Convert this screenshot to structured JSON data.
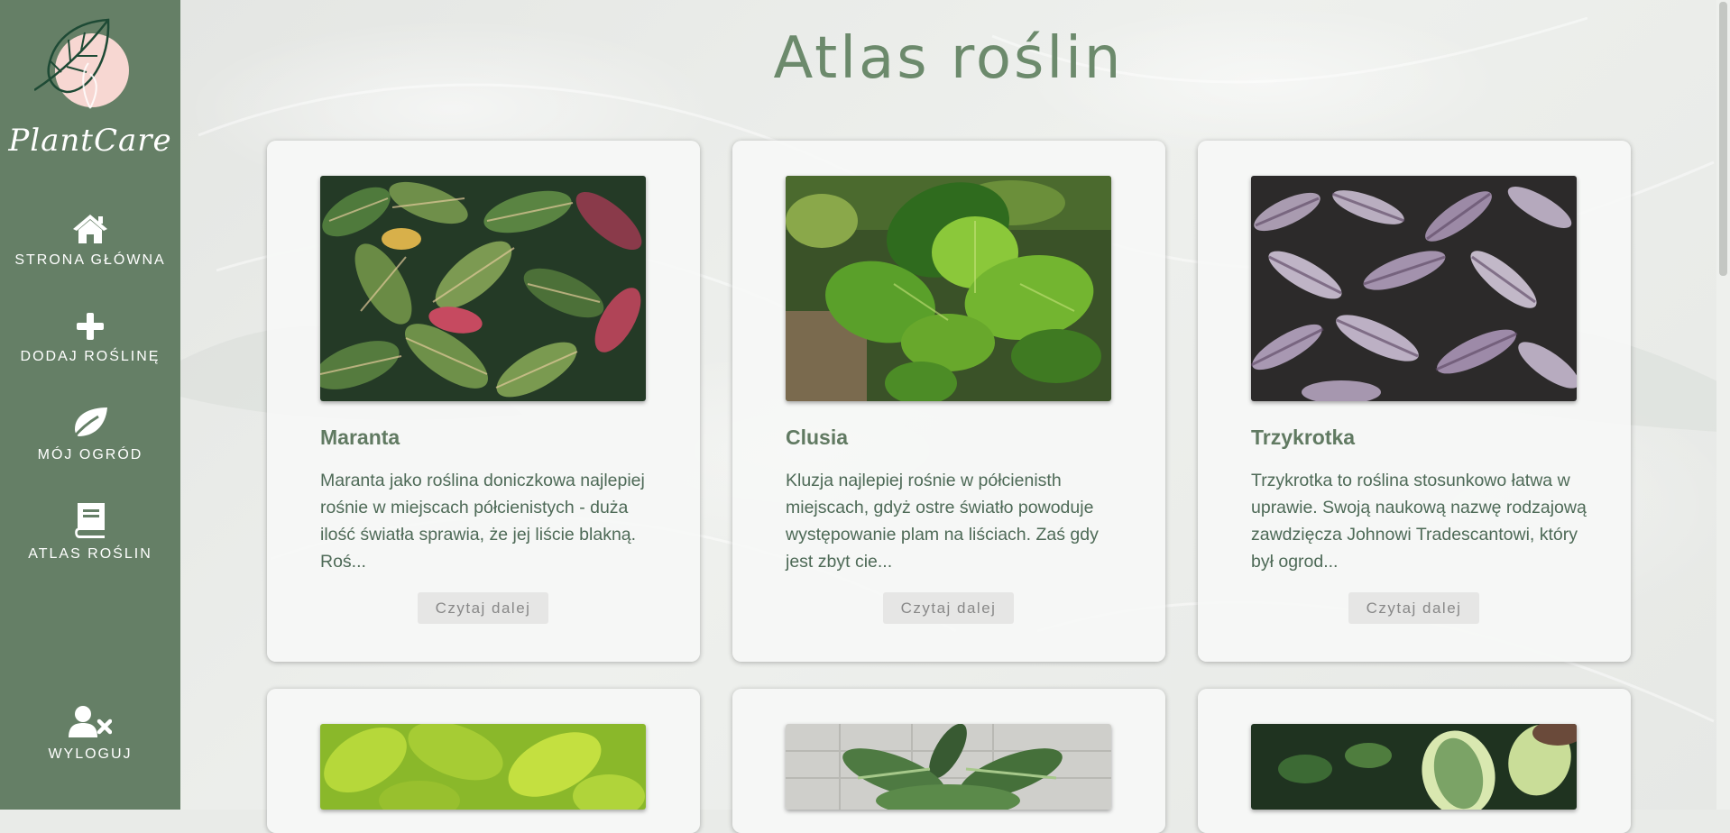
{
  "brand": {
    "name": "PlantCare"
  },
  "sidebar": {
    "items": [
      {
        "label": "STRONA GŁÓWNA",
        "icon": "home-icon"
      },
      {
        "label": "DODAJ ROŚLINĘ",
        "icon": "plus-icon"
      },
      {
        "label": "MÓJ OGRÓD",
        "icon": "leaf-icon"
      },
      {
        "label": "ATLAS ROŚLIN",
        "icon": "book-icon"
      }
    ],
    "logout": {
      "label": "WYLOGUJ",
      "icon": "user-remove-icon"
    }
  },
  "page": {
    "title": "Atlas roślin"
  },
  "cards": [
    {
      "title": "Maranta",
      "text": "Maranta jako roślina doniczkowa najlepiej rośnie w miejscach półcienistych - duża ilość światła sprawia, że jej liście blakną. Roś...",
      "button": "Czytaj dalej"
    },
    {
      "title": "Clusia",
      "text": "Kluzja najlepiej rośnie w półcienisth miejscach, gdyż ostre światło powoduje występowanie plam na liściach. Zaś gdy jest zbyt cie...",
      "button": "Czytaj dalej"
    },
    {
      "title": "Trzykrotka",
      "text": "Trzykrotka to roślina stosunkowo łatwa w uprawie. Swoją naukową nazwę rodzajową zawdzięcza Johnowi Tradescantowi, który był ogrod...",
      "button": "Czytaj dalej"
    }
  ],
  "colors": {
    "sidebar": "#657f66",
    "accent": "#6c8a6c",
    "logo_circle": "#f7d7d2"
  }
}
